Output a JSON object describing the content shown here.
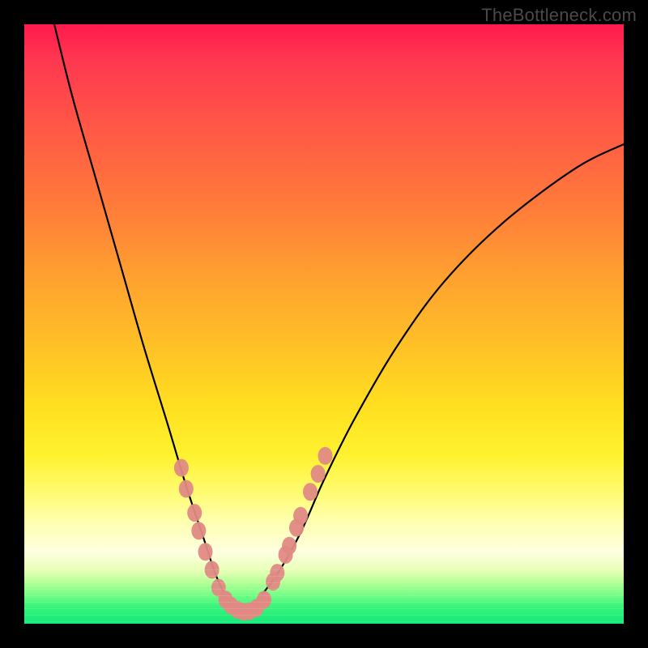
{
  "watermark": "TheBottleneck.com",
  "chart_data": {
    "type": "line",
    "title": "",
    "xlabel": "",
    "ylabel": "",
    "ylim": [
      0,
      100
    ],
    "xlim": [
      0,
      100
    ],
    "series": [
      {
        "name": "bottleneck-curve",
        "x": [
          5,
          8,
          12,
          16,
          20,
          24,
          27,
          30,
          32,
          34,
          36,
          38,
          42,
          46,
          50,
          55,
          62,
          70,
          80,
          92,
          100
        ],
        "y": [
          100,
          88,
          74,
          60,
          46,
          33,
          23,
          14,
          8,
          4,
          2,
          3,
          8,
          15,
          24,
          34,
          46,
          57,
          67,
          76,
          80
        ]
      }
    ],
    "markers": {
      "name": "highlighted-points",
      "color": "#e08a84",
      "points": [
        {
          "x": 26.2,
          "y": 26
        },
        {
          "x": 27.0,
          "y": 22.5
        },
        {
          "x": 28.4,
          "y": 18.5
        },
        {
          "x": 29.1,
          "y": 15.5
        },
        {
          "x": 30.2,
          "y": 12
        },
        {
          "x": 31.3,
          "y": 9
        },
        {
          "x": 32.4,
          "y": 6
        },
        {
          "x": 33.6,
          "y": 4
        },
        {
          "x": 34.5,
          "y": 3
        },
        {
          "x": 35.6,
          "y": 2.3
        },
        {
          "x": 36.6,
          "y": 2
        },
        {
          "x": 37.6,
          "y": 2.1
        },
        {
          "x": 38.7,
          "y": 2.6
        },
        {
          "x": 40.0,
          "y": 4
        },
        {
          "x": 41.5,
          "y": 7
        },
        {
          "x": 42.2,
          "y": 8.5
        },
        {
          "x": 43.6,
          "y": 11.5
        },
        {
          "x": 44.2,
          "y": 13
        },
        {
          "x": 45.4,
          "y": 16
        },
        {
          "x": 46.1,
          "y": 18
        },
        {
          "x": 47.7,
          "y": 22
        },
        {
          "x": 49.0,
          "y": 25
        },
        {
          "x": 50.2,
          "y": 28
        }
      ]
    },
    "background_gradient": {
      "top": "#ff1a4d",
      "mid": "#ffe020",
      "bottom": "#12e878"
    }
  }
}
